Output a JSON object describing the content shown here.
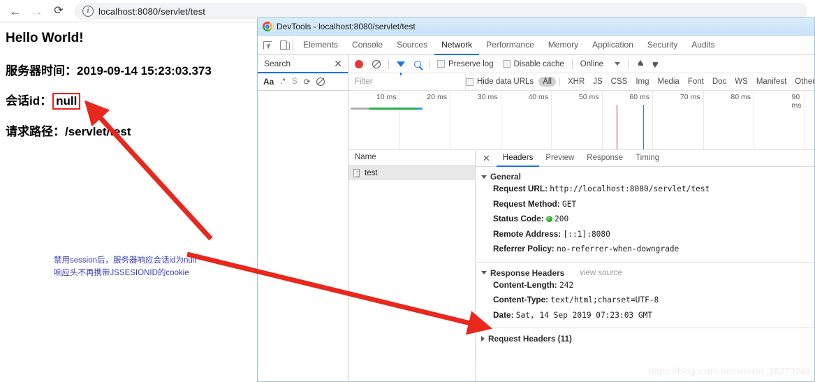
{
  "browser": {
    "back_icon": "back-arrow-icon",
    "forward_icon": "forward-arrow-icon",
    "reload_icon": "reload-icon",
    "info_icon": "i",
    "url": "localhost:8080/servlet/test"
  },
  "page": {
    "heading": "Hello World!",
    "server_time_label": "服务器时间：",
    "server_time_value": "2019-09-14 15:23:03.373",
    "session_label": "会话id：",
    "session_value": "null",
    "path_label": "请求路径：",
    "path_value": "/servlet/test",
    "annotation_line1": "禁用session后，服务器响应会话id为null",
    "annotation_line2": "响应头不再携带JSSESIONID的cookie",
    "highlight_color": "#e8271d",
    "arrow_color": "#e8271d"
  },
  "devtools": {
    "title": "DevTools - localhost:8080/servlet/test",
    "panel_tabs": [
      {
        "label": "Elements",
        "active": false
      },
      {
        "label": "Console",
        "active": false
      },
      {
        "label": "Sources",
        "active": false
      },
      {
        "label": "Network",
        "active": true
      },
      {
        "label": "Performance",
        "active": false
      },
      {
        "label": "Memory",
        "active": false
      },
      {
        "label": "Application",
        "active": false
      },
      {
        "label": "Security",
        "active": false
      },
      {
        "label": "Audits",
        "active": false
      }
    ],
    "accent_color": "#1a73e8",
    "search_pane": {
      "title": "Search",
      "close_icon": "close-icon",
      "tools": [
        "Aa",
        ".*",
        "S"
      ]
    },
    "network_toolbar": {
      "record_icon": "record-icon",
      "clear_icon": "clear-icon",
      "filter_icon": "filter-icon",
      "search_icon": "search-icon",
      "preserve_log": "Preserve log",
      "disable_cache": "Disable cache",
      "throttling": "Online",
      "import_icon": "upload-icon",
      "export_icon": "download-icon"
    },
    "filter_bar": {
      "filter_placeholder": "Filter",
      "hide_data_urls": "Hide data URLs",
      "resource_types": [
        "All",
        "XHR",
        "JS",
        "CSS",
        "Img",
        "Media",
        "Font",
        "Doc",
        "WS",
        "Manifest",
        "Other"
      ],
      "selected_type": "All"
    },
    "overview": {
      "ticks": [
        "10 ms",
        "20 ms",
        "30 ms",
        "40 ms",
        "50 ms",
        "60 ms",
        "70 ms",
        "80 ms",
        "90 ms"
      ],
      "bar_segments": [
        {
          "color": "#b0b0b0",
          "start_pct": 0.5,
          "width_pct": 4.0
        },
        {
          "color": "#22b14c",
          "start_pct": 4.5,
          "width_pct": 10.2
        },
        {
          "color": "#3b9ae1",
          "start_pct": 14.7,
          "width_pct": 1.2
        }
      ],
      "markers": [
        {
          "color": "#b33030",
          "pos_pct": 57.5
        },
        {
          "color": "#3b79c4",
          "pos_pct": 63.3
        }
      ]
    },
    "requests": {
      "column_header": "Name",
      "rows": [
        {
          "name": "test",
          "icon": "document-icon",
          "selected": true
        }
      ]
    },
    "detail": {
      "close_icon": "close-icon",
      "tabs": [
        {
          "label": "Headers",
          "active": true
        },
        {
          "label": "Preview",
          "active": false
        },
        {
          "label": "Response",
          "active": false
        },
        {
          "label": "Timing",
          "active": false
        }
      ],
      "general": {
        "title": "General",
        "rows": [
          {
            "key": "Request URL:",
            "value": "http://localhost:8080/servlet/test"
          },
          {
            "key": "Request Method:",
            "value": "GET"
          },
          {
            "key": "Status Code:",
            "value": "200",
            "status_dot": true
          },
          {
            "key": "Remote Address:",
            "value": "[::1]:8080"
          },
          {
            "key": "Referrer Policy:",
            "value": "no-referrer-when-downgrade"
          }
        ]
      },
      "response_headers": {
        "title": "Response Headers",
        "view_source": "view source",
        "rows": [
          {
            "key": "Content-Length:",
            "value": "242"
          },
          {
            "key": "Content-Type:",
            "value": "text/html;charset=UTF-8"
          },
          {
            "key": "Date:",
            "value": "Sat, 14 Sep 2019 07:23:03 GMT"
          }
        ]
      },
      "request_headers": {
        "title": "Request Headers (11)"
      }
    }
  },
  "watermark": "https://blog.csdn.net/weixin_38270240"
}
